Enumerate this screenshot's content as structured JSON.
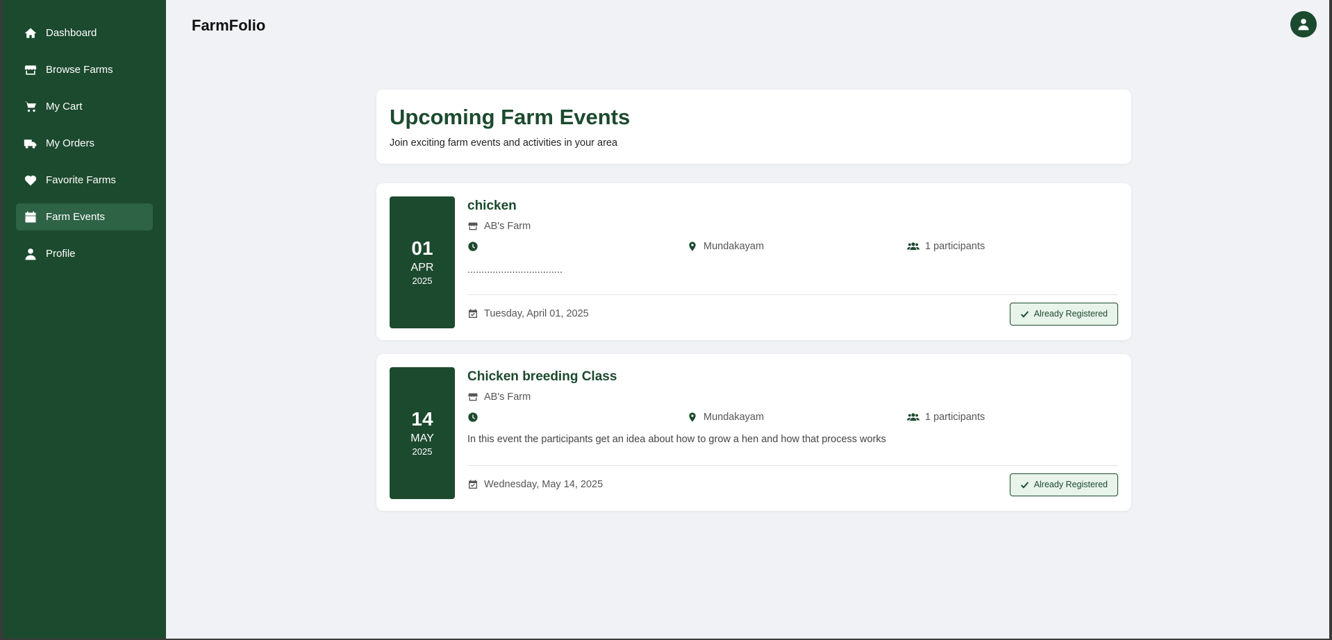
{
  "app": {
    "brand": "FarmFolio"
  },
  "sidebar": {
    "items": [
      {
        "label": "Dashboard",
        "icon": "home-icon"
      },
      {
        "label": "Browse Farms",
        "icon": "store-icon"
      },
      {
        "label": "My Cart",
        "icon": "cart-icon"
      },
      {
        "label": "My Orders",
        "icon": "truck-icon"
      },
      {
        "label": "Favorite Farms",
        "icon": "heart-icon"
      },
      {
        "label": "Farm Events",
        "icon": "calendar-icon",
        "active": true
      },
      {
        "label": "Profile",
        "icon": "user-icon"
      }
    ]
  },
  "page": {
    "title": "Upcoming Farm Events",
    "subtitle": "Join exciting farm events and activities in your area"
  },
  "events": [
    {
      "day": "01",
      "month": "APR",
      "year": "2025",
      "title": "chicken",
      "farm": "AB's Farm",
      "time": "",
      "location": "Mundakayam",
      "participants": "1 participants",
      "description": "..................................",
      "full_date": "Tuesday, April 01, 2025",
      "status": "Already Registered"
    },
    {
      "day": "14",
      "month": "MAY",
      "year": "2025",
      "title": "Chicken breeding Class",
      "farm": "AB's Farm",
      "time": "",
      "location": "Mundakayam",
      "participants": "1 participants",
      "description": "In this event the participants get an idea about how to grow a hen and how that process works",
      "full_date": "Wednesday, May 14, 2025",
      "status": "Already Registered"
    }
  ],
  "colors": {
    "primary": "#1c4a2e",
    "sidebar_active": "#2f6346",
    "background": "#f0f2f5",
    "registered_bg": "#e8f3ea"
  }
}
